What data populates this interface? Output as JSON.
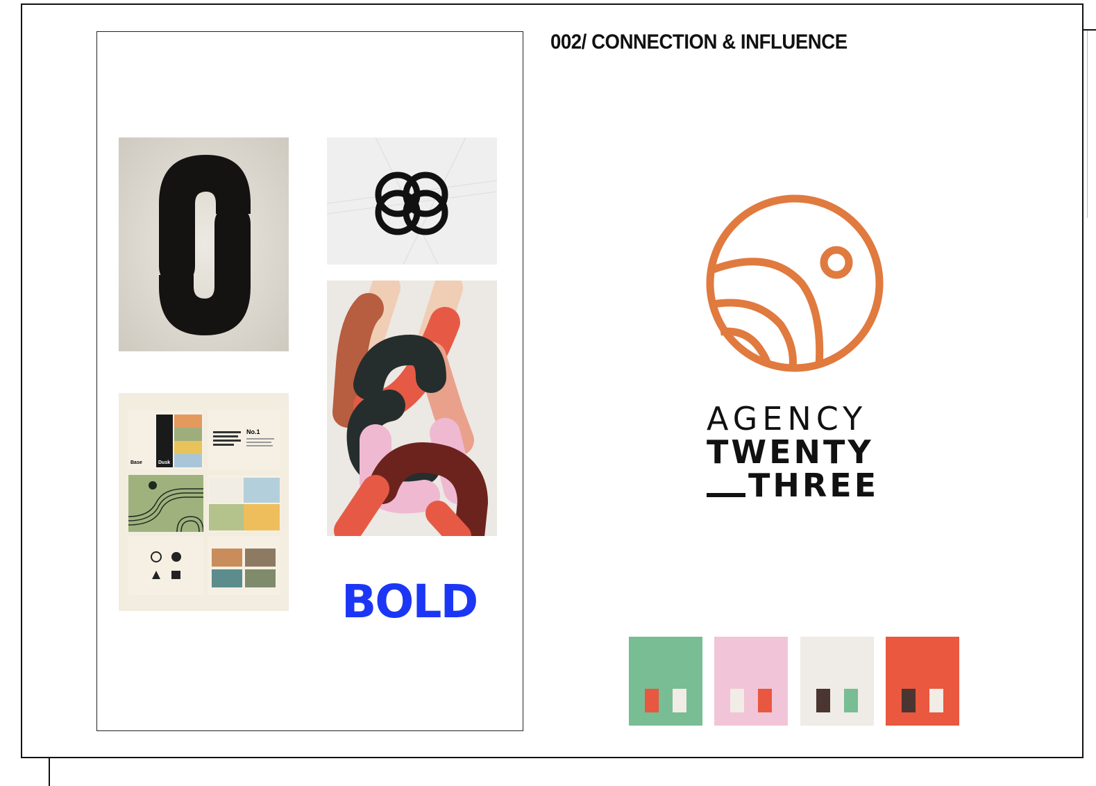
{
  "header": {
    "title": "002/ CONNECTION & INFLUENCE"
  },
  "logo": {
    "lines": [
      "AGENCY",
      "TWENTY",
      "THREE"
    ],
    "accent_color": "#e07a3f",
    "text_color": "#111111"
  },
  "moodboard": {
    "bold_logo_text": "BOLD",
    "bold_color": "#1b37f5",
    "items": [
      {
        "name": "interlocking-s-poster"
      },
      {
        "name": "knot-circle-logo"
      },
      {
        "name": "chain-links-poster"
      },
      {
        "name": "brand-guidelines-grid"
      },
      {
        "name": "bold-logo"
      }
    ],
    "guideline_texts": [
      "No.1",
      "Base",
      "Dusk"
    ]
  },
  "palette": [
    {
      "base": "#78bd93",
      "chips": [
        "#e8573f",
        "#f1ece6"
      ]
    },
    {
      "base": "#f2c4d8",
      "chips": [
        "#f1ece6",
        "#e8573f"
      ]
    },
    {
      "base": "#efebe6",
      "chips": [
        "#4a3530",
        "#78bd93"
      ]
    },
    {
      "base": "#e9583f",
      "chips": [
        "#4a3530",
        "#f1ece6"
      ]
    }
  ]
}
